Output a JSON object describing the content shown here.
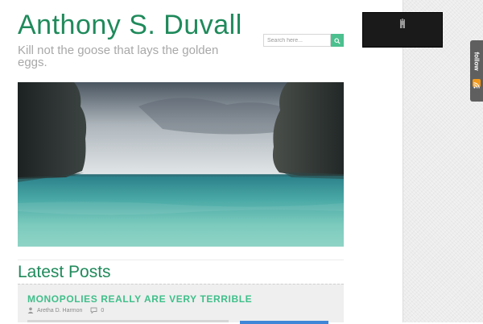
{
  "site": {
    "title": "Anthony S. Duvall",
    "tagline": "Kill not the goose that lays the golden eggs."
  },
  "search": {
    "placeholder": "Search here...",
    "button_icon": "search-icon"
  },
  "sidebar": {
    "follow_label": "follow",
    "rss_icon": "rss-icon",
    "widget_icon": "castle-icon"
  },
  "hero": {
    "image": "tropical-sea-cliffs-photo"
  },
  "latest": {
    "heading": "Latest Posts",
    "posts": [
      {
        "title": "MONOPOLIES REALLY ARE VERY TERRIBLE",
        "author": "Aretha D. Harmon",
        "comments": "0"
      }
    ]
  },
  "colors": {
    "brand_green": "#1f8a5b",
    "accent_green": "#3fbf8a",
    "search_button": "#4cc08f",
    "tagline_gray": "#a8a8a8",
    "rss_orange": "#f39a1d",
    "link_blue": "#3f86d8"
  }
}
